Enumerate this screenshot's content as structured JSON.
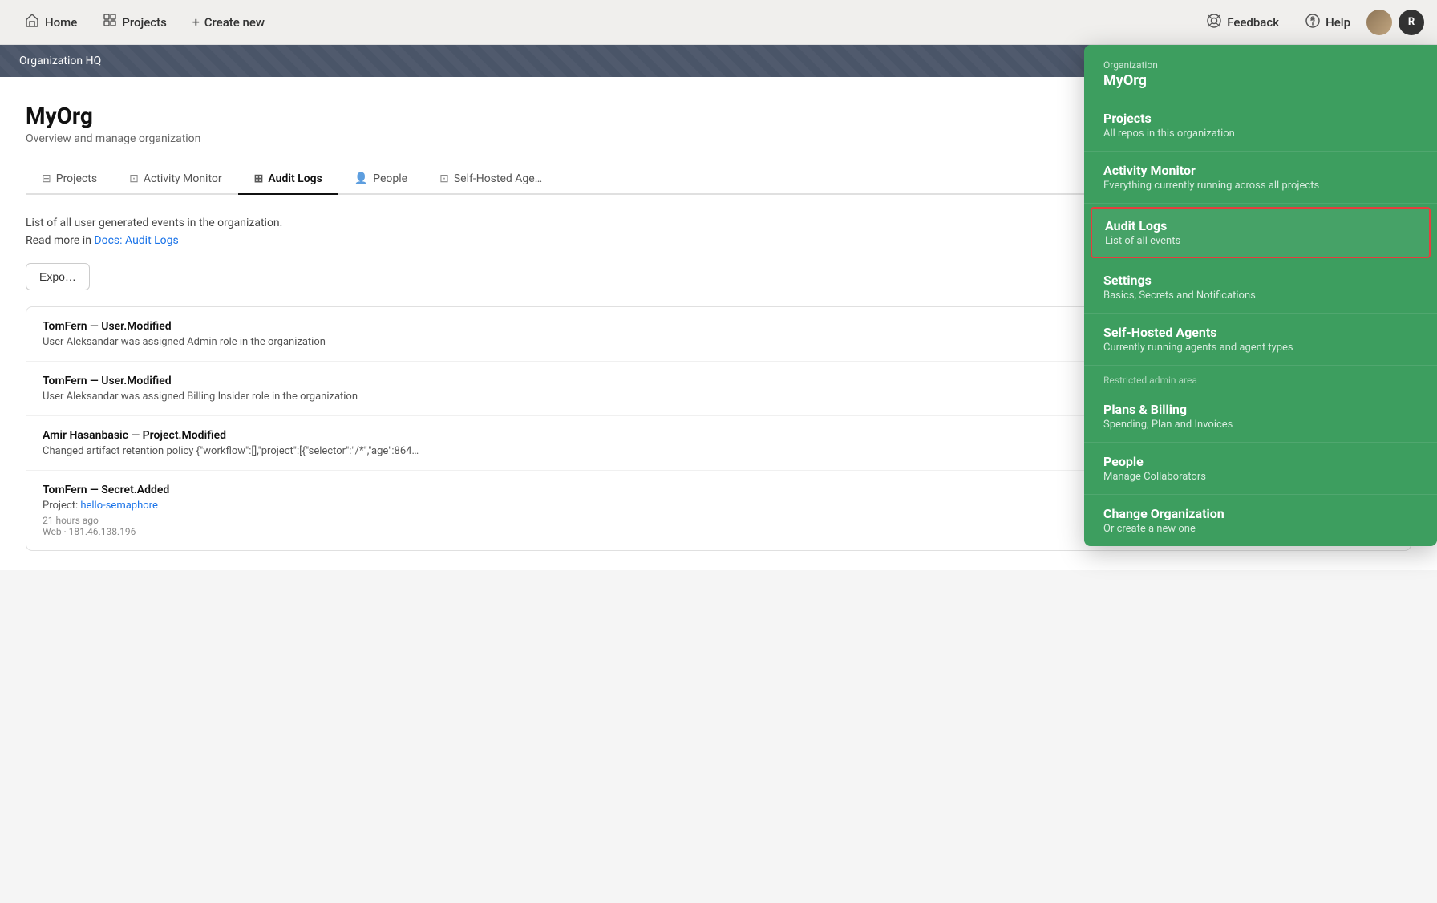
{
  "nav": {
    "home_label": "Home",
    "projects_label": "Projects",
    "create_new_label": "Create new",
    "feedback_label": "Feedback",
    "help_label": "Help",
    "user_initial": "R"
  },
  "org_banner": {
    "label": "Organization HQ"
  },
  "page": {
    "title": "MyOrg",
    "subtitle": "Overview and manage organization"
  },
  "tabs": [
    {
      "id": "projects",
      "label": "Projects",
      "icon": "⊟"
    },
    {
      "id": "activity-monitor",
      "label": "Activity Monitor",
      "icon": "⊡"
    },
    {
      "id": "audit-logs",
      "label": "Audit Logs",
      "icon": "⊞",
      "active": true
    },
    {
      "id": "people",
      "label": "People",
      "icon": "👤"
    },
    {
      "id": "self-hosted",
      "label": "Self-Hosted Age…",
      "icon": "⊡"
    }
  ],
  "content": {
    "desc_line1": "List of all user generated events in the organization.",
    "desc_link_text": "Docs: Audit Logs",
    "desc_link_prefix": "Read more in ",
    "export_label": "Expo…"
  },
  "log_entries": [
    {
      "actor": "TomFern — User.Modified",
      "detail": "User Aleksandar was assigned Admin role in the organization",
      "link": null
    },
    {
      "actor": "TomFern — User.Modified",
      "detail": "User Aleksandar was assigned Billing Insider role in the organization",
      "link": null
    },
    {
      "actor": "Amir Hasanbasic — Project.Modified",
      "detail": "Changed artifact retention policy {\"workflow\":[],\"project\":[{\"selector\":\"/*\",\"age\":864…",
      "link": null
    },
    {
      "actor": "TomFern — Secret.Added",
      "detail_prefix": "Project: ",
      "detail_link": "hello-semaphore",
      "meta1": "21 hours ago",
      "meta2": "Web · 181.46.138.196"
    }
  ],
  "dropdown": {
    "org_label": "Organization",
    "org_name": "MyOrg",
    "items": [
      {
        "id": "projects",
        "title": "Projects",
        "desc": "All repos in this organization",
        "active": false,
        "divider_before": false
      },
      {
        "id": "activity-monitor",
        "title": "Activity Monitor",
        "desc": "Everything currently running across all projects",
        "active": false,
        "divider_before": false
      },
      {
        "id": "audit-logs",
        "title": "Audit Logs",
        "desc": "List of all events",
        "active": true,
        "divider_before": false
      },
      {
        "id": "settings",
        "title": "Settings",
        "desc": "Basics, Secrets and Notifications",
        "active": false,
        "divider_before": false
      },
      {
        "id": "self-hosted-agents",
        "title": "Self-Hosted Agents",
        "desc": "Currently running agents and agent types",
        "active": false,
        "divider_before": false
      },
      {
        "id": "plans-billing",
        "title": "Plans & Billing",
        "desc": "Spending, Plan and Invoices",
        "active": false,
        "divider_before": true,
        "divider_label": "Restricted admin area"
      },
      {
        "id": "people",
        "title": "People",
        "desc": "Manage Collaborators",
        "active": false,
        "divider_before": false
      },
      {
        "id": "change-organization",
        "title": "Change Organization",
        "desc": "Or create a new one",
        "active": false,
        "divider_before": false
      }
    ]
  }
}
